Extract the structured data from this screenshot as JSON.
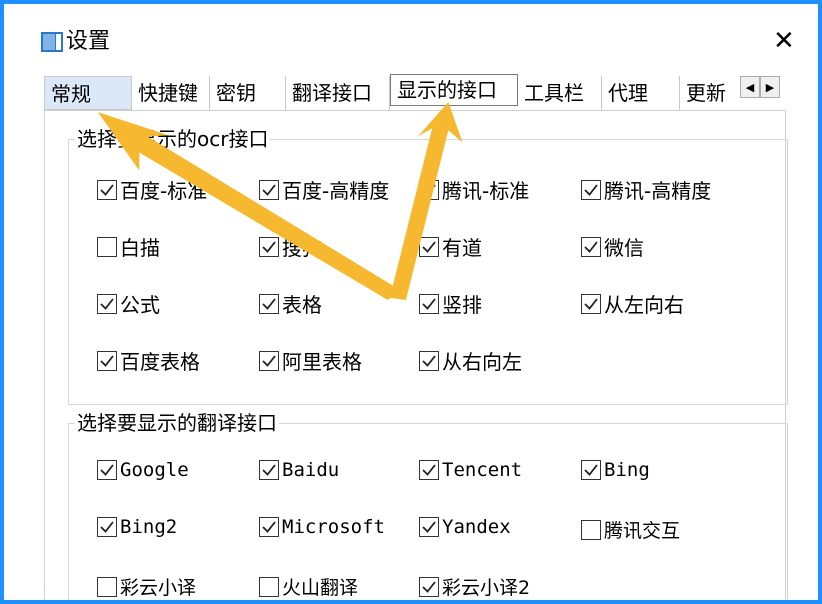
{
  "window": {
    "title": "设置",
    "close_glyph": "✕"
  },
  "tabs": [
    {
      "label": "常规"
    },
    {
      "label": "快捷键"
    },
    {
      "label": "密钥"
    },
    {
      "label": "翻译接口"
    },
    {
      "label": "显示的接口",
      "active": true
    },
    {
      "label": "工具栏"
    },
    {
      "label": "代理"
    },
    {
      "label": "更新"
    }
  ],
  "tab_scroll": {
    "left": "◀",
    "right": "▶"
  },
  "ocr_group": {
    "title": "选择要显示的ocr接口",
    "options": [
      {
        "label": "百度-标准",
        "checked": true
      },
      {
        "label": "百度-高精度",
        "checked": true
      },
      {
        "label": "腾讯-标准",
        "checked": true
      },
      {
        "label": "腾讯-高精度",
        "checked": true
      },
      {
        "label": "白描",
        "checked": false
      },
      {
        "label": "搜狗",
        "checked": true
      },
      {
        "label": "有道",
        "checked": true
      },
      {
        "label": "微信",
        "checked": true
      },
      {
        "label": "公式",
        "checked": true
      },
      {
        "label": "表格",
        "checked": true
      },
      {
        "label": "竖排",
        "checked": true
      },
      {
        "label": "从左向右",
        "checked": true
      },
      {
        "label": "百度表格",
        "checked": true
      },
      {
        "label": "阿里表格",
        "checked": true
      },
      {
        "label": "从右向左",
        "checked": true
      }
    ]
  },
  "translate_group": {
    "title": "选择要显示的翻译接口",
    "options": [
      {
        "label": "Google",
        "checked": true
      },
      {
        "label": "Baidu",
        "checked": true
      },
      {
        "label": "Tencent",
        "checked": true
      },
      {
        "label": "Bing",
        "checked": true
      },
      {
        "label": "Bing2",
        "checked": true
      },
      {
        "label": "Microsoft",
        "checked": true
      },
      {
        "label": "Yandex",
        "checked": true
      },
      {
        "label": "腾讯交互",
        "checked": false
      },
      {
        "label": "彩云小译",
        "checked": false
      },
      {
        "label": "火山翻译",
        "checked": false
      },
      {
        "label": "彩云小译2",
        "checked": true
      }
    ]
  },
  "colors": {
    "frame": "#1e90ff",
    "arrow": "#f5b82e",
    "active_tab_bg": "#dbe8f7"
  },
  "icons": {
    "app": "window-icon",
    "close": "close-icon",
    "check": "checkmark-icon"
  }
}
